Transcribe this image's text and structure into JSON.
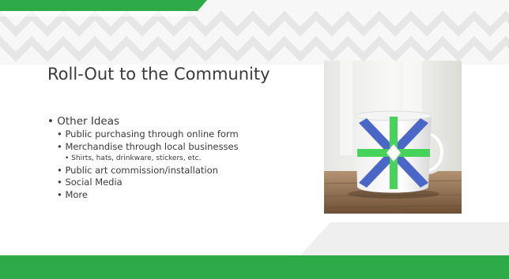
{
  "slide": {
    "title": "Roll-Out to the Community",
    "bullets": [
      {
        "level": 1,
        "text": "• Other Ideas"
      },
      {
        "level": 2,
        "text": "• Public purchasing through online form"
      },
      {
        "level": 2,
        "text": "• Merchandise through local businesses"
      },
      {
        "level": 3,
        "text": "• Shirts, hats, drinkware, stickers, etc."
      },
      {
        "level": 2,
        "text": "• Public art commission/installation"
      },
      {
        "level": 2,
        "text": "• Social Media"
      },
      {
        "level": 2,
        "text": "• More"
      }
    ]
  },
  "colors": {
    "accent_green": "#2eab48",
    "zigzag_gray": "#ececec",
    "text": "#3a3a3a"
  },
  "image": {
    "subject": "white mug with blue and green star logo on wooden table"
  }
}
